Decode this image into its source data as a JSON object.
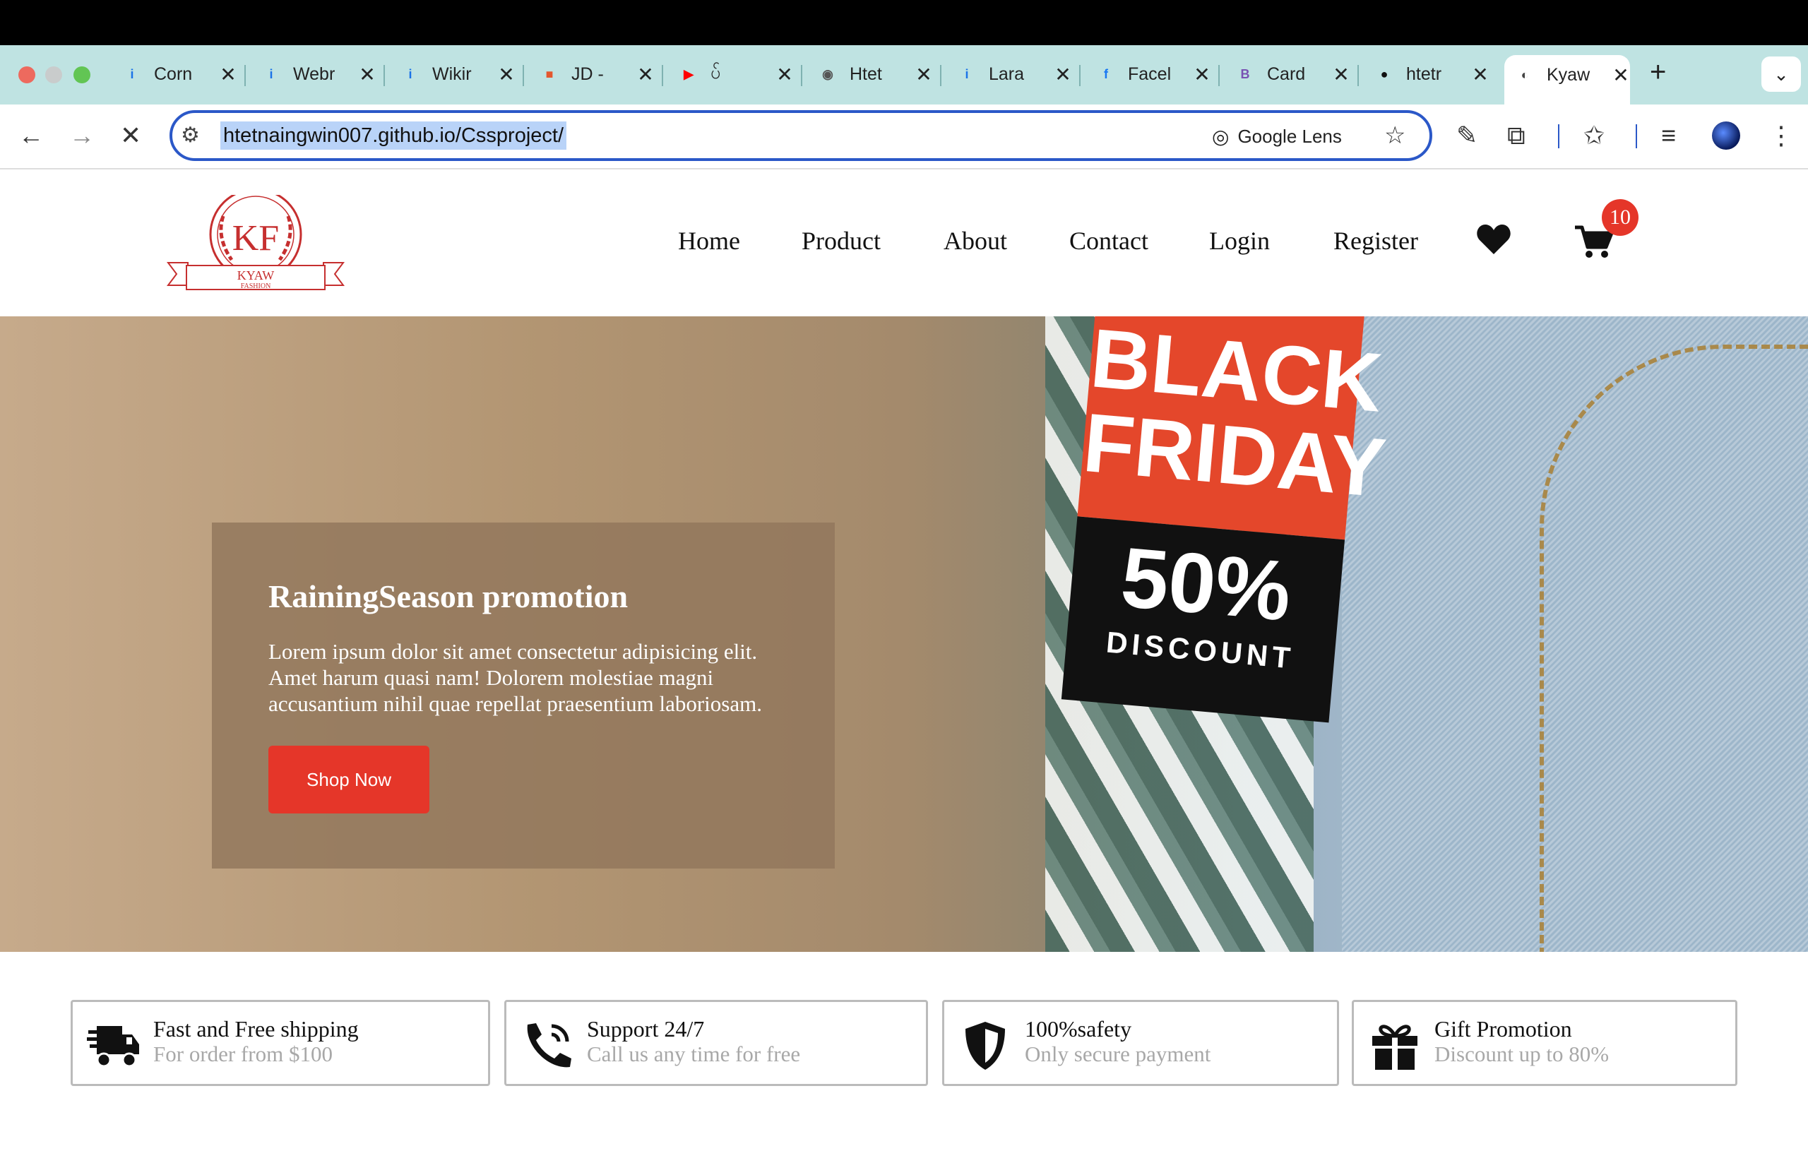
{
  "browser": {
    "tabs": [
      {
        "label": "Corn",
        "icon": "info-icon",
        "icon_char": "i",
        "icon_color": "#1a73e8"
      },
      {
        "label": "Webr",
        "icon": "info-icon",
        "icon_char": "i",
        "icon_color": "#1a73e8"
      },
      {
        "label": "Wikir",
        "icon": "info-icon",
        "icon_char": "i",
        "icon_color": "#1a73e8"
      },
      {
        "label": "JD -",
        "icon": "jd-icon",
        "icon_char": "■",
        "icon_color": "#e4572e"
      },
      {
        "label": "ပ်",
        "icon": "youtube-icon",
        "icon_char": "▶",
        "icon_color": "#ff0000"
      },
      {
        "label": "Htet",
        "icon": "globe-icon",
        "icon_char": "◉",
        "icon_color": "#555"
      },
      {
        "label": "Lara",
        "icon": "info-icon",
        "icon_char": "i",
        "icon_color": "#1a73e8"
      },
      {
        "label": "Facel",
        "icon": "facebook-icon",
        "icon_char": "f",
        "icon_color": "#1877f2"
      },
      {
        "label": "Card",
        "icon": "bootstrap-icon",
        "icon_char": "B",
        "icon_color": "#7952b3"
      },
      {
        "label": "htetr",
        "icon": "github-icon",
        "icon_char": "●",
        "icon_color": "#111"
      },
      {
        "label": "Kyaw",
        "icon": "loading-icon",
        "icon_char": "◐",
        "icon_color": "#444"
      }
    ],
    "close_glyph": "✕",
    "new_tab": "+",
    "url": "htetnaingwin007.github.io/Cssproject/",
    "lens_label": "Google Lens",
    "accent": "#2b58c8"
  },
  "site": {
    "logo": {
      "initials": "KF",
      "name": "KYAW",
      "sub": "FASHION",
      "color": "#c62f2f"
    },
    "nav": [
      "Home",
      "Product",
      "About",
      "Contact",
      "Login",
      "Register"
    ],
    "cart_count": "10",
    "hero": {
      "title": "RainingSeason promotion",
      "text": "Lorem ipsum dolor sit amet consectetur adipisicing elit. Amet harum quasi nam! Dolorem molestiae magni accusantium nihil quae repellat praesentium laboriosam.",
      "button": "Shop Now",
      "tag_line1": "BLACK",
      "tag_line2": "FRIDAY",
      "tag_pct": "50%",
      "tag_disc": "DISCOUNT"
    },
    "features": [
      {
        "title": "Fast and Free shipping",
        "sub": "For order from $100",
        "icon": "truck-icon"
      },
      {
        "title": "Support 24/7",
        "sub": "Call us any time for free",
        "icon": "phone-icon"
      },
      {
        "title": "100%safety",
        "sub": "Only secure payment",
        "icon": "shield-icon"
      },
      {
        "title": "Gift Promotion",
        "sub": "Discount up to 80%",
        "icon": "gift-icon"
      }
    ]
  }
}
